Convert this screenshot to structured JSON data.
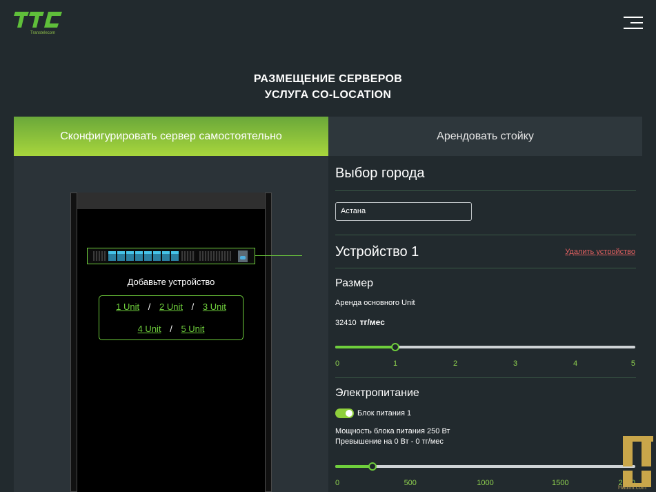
{
  "logo": {
    "text": "TTC",
    "subtitle": "Transtelecom"
  },
  "header": {
    "title_line1": "РАЗМЕЩЕНИЕ СЕРВЕРОВ",
    "title_line2": "УСЛУГА CO-LOCATION"
  },
  "tabs": [
    {
      "label": "Сконфигурировать сервер самостоятельно",
      "active": true
    },
    {
      "label": "Арендовать стойку",
      "active": false
    }
  ],
  "rack": {
    "add_device_label": "Добавьте устройство",
    "unit_links": [
      "1 Unit",
      "2 Unit",
      "3 Unit",
      "4 Unit",
      "5 Unit"
    ],
    "separator": "/"
  },
  "city": {
    "heading": "Выбор города",
    "value": "Астана"
  },
  "device": {
    "heading": "Устройство 1",
    "delete_label": "Удалить устройство"
  },
  "size": {
    "heading": "Размер",
    "rent_label": "Аренда основного Unit",
    "price": "32410",
    "price_unit": "тг/мес",
    "slider_value": 1,
    "slider_min": 0,
    "slider_max": 5,
    "ticks": [
      "0",
      "1",
      "2",
      "3",
      "4",
      "5"
    ]
  },
  "power": {
    "heading": "Электропитание",
    "toggle_label": "Блок питания 1",
    "toggle_on": true,
    "power_line": "Мощность блока питания 250 Вт",
    "excess_line": "Превышение на 0 Вт - 0 тг/мес",
    "slider_value": 250,
    "slider_min": 0,
    "slider_max": 2000,
    "ticks": [
      "0",
      "500",
      "1000",
      "1500",
      "2000"
    ]
  },
  "watermark": {
    "text": "TT",
    "caption": "Hatrim.com"
  },
  "colors": {
    "accent": "#6fcf3c",
    "background": "#222a2e",
    "panel": "#2b3338",
    "danger": "#e06060"
  }
}
